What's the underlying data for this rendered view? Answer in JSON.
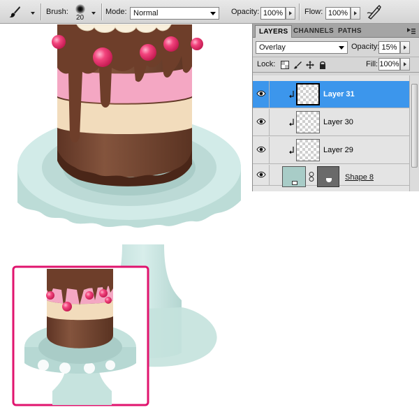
{
  "options_bar": {
    "tool_preset_icon": "brush-icon",
    "brush_label": "Brush:",
    "brush_size": "20",
    "mode_label": "Mode:",
    "mode_value": "Normal",
    "opacity_label": "Opacity:",
    "opacity_value": "100%",
    "flow_label": "Flow:",
    "flow_value": "100%",
    "airbrush_icon": "airbrush-icon"
  },
  "layers_panel": {
    "tabs": [
      {
        "label": "LAYERS",
        "active": true
      },
      {
        "label": "CHANNELS",
        "active": false
      },
      {
        "label": "PATHS",
        "active": false
      }
    ],
    "blend_mode": "Overlay",
    "opacity_label": "Opacity:",
    "opacity_value": "15%",
    "lock_label": "Lock:",
    "fill_label": "Fill:",
    "fill_value": "100%",
    "layers": [
      {
        "name": "Layer 31",
        "selected": true,
        "visible": true,
        "clipped": true
      },
      {
        "name": "Layer 30",
        "selected": false,
        "visible": true,
        "clipped": true
      },
      {
        "name": "Layer 29",
        "selected": false,
        "visible": true,
        "clipped": true
      },
      {
        "name": "Shape 8",
        "selected": false,
        "visible": true,
        "clipped": false
      }
    ]
  },
  "colors": {
    "selection_blue": "#3c96ec",
    "preview_frame": "#e0146e",
    "stand_aqua": "#c8e4e0",
    "chocolate": "#7a4a35",
    "pink_layer": "#f4a6c2",
    "cream_layer": "#f3e0c4",
    "candy_pink": "#f0407a"
  }
}
